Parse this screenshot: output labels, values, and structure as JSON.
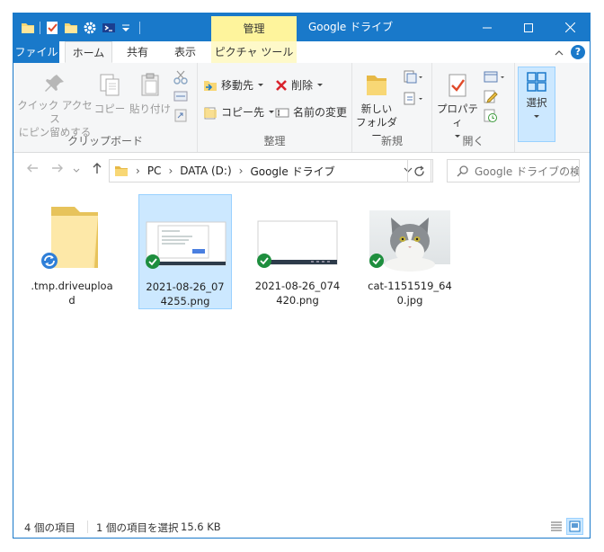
{
  "titlebar": {
    "context_tab": "管理",
    "title": "Google ドライブ",
    "minimize": "—",
    "maximize": "☐",
    "close": "✕"
  },
  "tabs": {
    "file": "ファイル",
    "home": "ホーム",
    "share": "共有",
    "view": "表示",
    "picture_tools": "ピクチャ ツール",
    "collapse": "^",
    "help": "?"
  },
  "ribbon": {
    "clipboard": {
      "label": "クリップボード",
      "pin_line1": "クイック アクセス",
      "pin_line2": "にピン留めする",
      "copy": "コピー",
      "paste": "貼り付け"
    },
    "organize": {
      "label": "整理",
      "move_to": "移動先",
      "copy_to": "コピー先",
      "delete": "削除",
      "rename": "名前の変更"
    },
    "new": {
      "label": "新規",
      "new_folder_line1": "新しい",
      "new_folder_line2": "フォルダー"
    },
    "open": {
      "label": "開く",
      "properties": "プロパティ"
    },
    "select": {
      "select": "選択"
    }
  },
  "address": {
    "crumbs": [
      "PC",
      "DATA (D:)",
      "Google ドライブ"
    ],
    "search_placeholder": "Google ドライブの検..."
  },
  "files": [
    {
      "name": ".tmp.driveupload",
      "type": "folder",
      "status": "syncing"
    },
    {
      "name": "2021-08-26_074255.png",
      "type": "image",
      "status": "synced",
      "selected": true
    },
    {
      "name": "2021-08-26_074420.png",
      "type": "image",
      "status": "synced"
    },
    {
      "name": "cat-1151519_640.jpg",
      "type": "photo",
      "status": "synced"
    }
  ],
  "status": {
    "item_count": "4 個の項目",
    "selection": "1 個の項目を選択",
    "size": "15.6 KB"
  },
  "colors": {
    "accent": "#1979ca",
    "context_tab": "#fef49c",
    "selection": "#cce8ff",
    "sync_green": "#1e8e3e",
    "sync_blue": "#2f7fd8"
  }
}
